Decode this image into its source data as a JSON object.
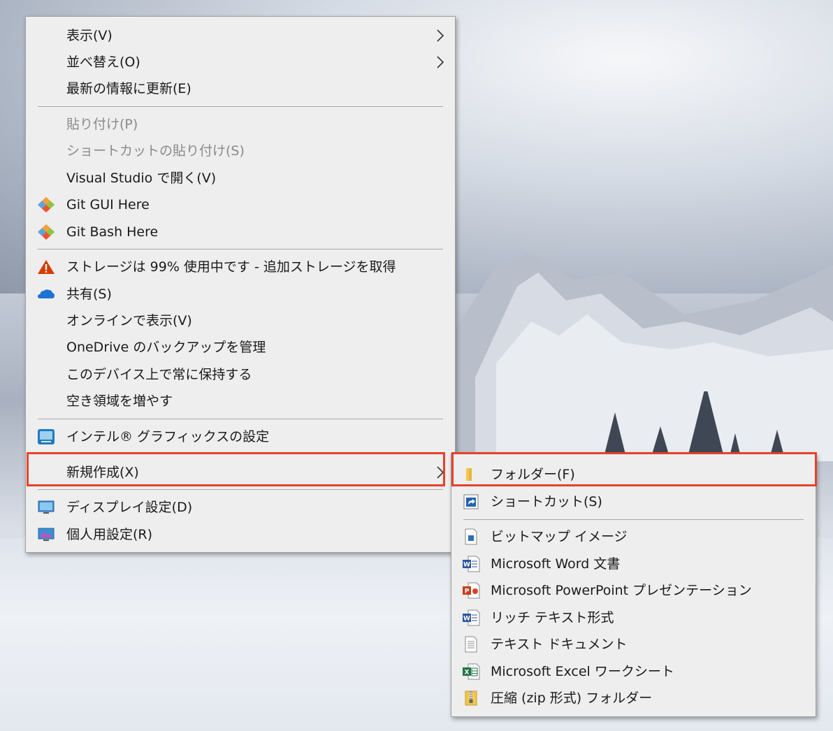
{
  "context_menu": {
    "items": [
      {
        "label": "表示(V)"
      },
      {
        "label": "並べ替え(O)"
      },
      {
        "label": "最新の情報に更新(E)"
      },
      {
        "label": "貼り付け(P)"
      },
      {
        "label": "ショートカットの貼り付け(S)"
      },
      {
        "label": "Visual Studio で開く(V)"
      },
      {
        "label": "Git GUI Here"
      },
      {
        "label": "Git Bash Here"
      },
      {
        "label": "ストレージは 99% 使用中です - 追加ストレージを取得"
      },
      {
        "label": "共有(S)"
      },
      {
        "label": "オンラインで表示(V)"
      },
      {
        "label": "OneDrive のバックアップを管理"
      },
      {
        "label": "このデバイス上で常に保持する"
      },
      {
        "label": "空き領域を増やす"
      },
      {
        "label": "インテル® グラフィックスの設定"
      },
      {
        "label": "新規作成(X)"
      },
      {
        "label": "ディスプレイ設定(D)"
      },
      {
        "label": "個人用設定(R)"
      }
    ]
  },
  "new_submenu": {
    "items": [
      {
        "label": "フォルダー(F)"
      },
      {
        "label": "ショートカット(S)"
      },
      {
        "label": "ビットマップ イメージ"
      },
      {
        "label": "Microsoft Word 文書"
      },
      {
        "label": "Microsoft PowerPoint プレゼンテーション"
      },
      {
        "label": "リッチ テキスト形式"
      },
      {
        "label": "テキスト ドキュメント"
      },
      {
        "label": "Microsoft Excel ワークシート"
      },
      {
        "label": "圧縮 (zip 形式) フォルダー"
      }
    ]
  },
  "colors": {
    "menu_background": "#eeeeee",
    "highlight_border": "#e4422a",
    "disabled_text": "#8a8a8a"
  }
}
